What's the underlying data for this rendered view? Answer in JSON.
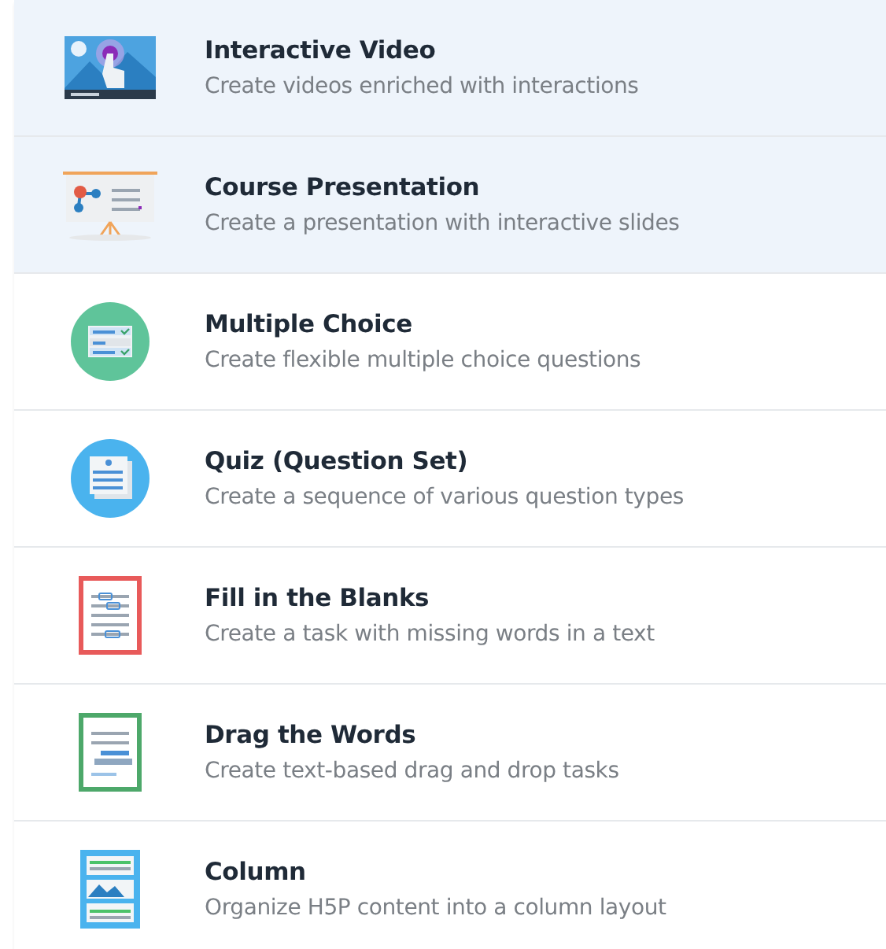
{
  "content_types": [
    {
      "kind": "video",
      "title": "Interactive Video",
      "description": "Create videos enriched with interactions",
      "highlighted": true
    },
    {
      "kind": "presentation",
      "title": "Course Presentation",
      "description": "Create a presentation with interactive slides",
      "highlighted": true
    },
    {
      "kind": "choice",
      "title": "Multiple Choice",
      "description": "Create flexible multiple choice questions",
      "highlighted": false
    },
    {
      "kind": "quiz",
      "title": "Quiz (Question Set)",
      "description": "Create a sequence of various question types",
      "highlighted": false
    },
    {
      "kind": "blanks",
      "title": "Fill in the Blanks",
      "description": "Create a task with missing words in a text",
      "highlighted": false
    },
    {
      "kind": "drag",
      "title": "Drag the Words",
      "description": "Create text-based drag and drop tasks",
      "highlighted": false
    },
    {
      "kind": "column",
      "title": "Column",
      "description": "Organize H5P content into a column layout",
      "highlighted": false
    }
  ]
}
